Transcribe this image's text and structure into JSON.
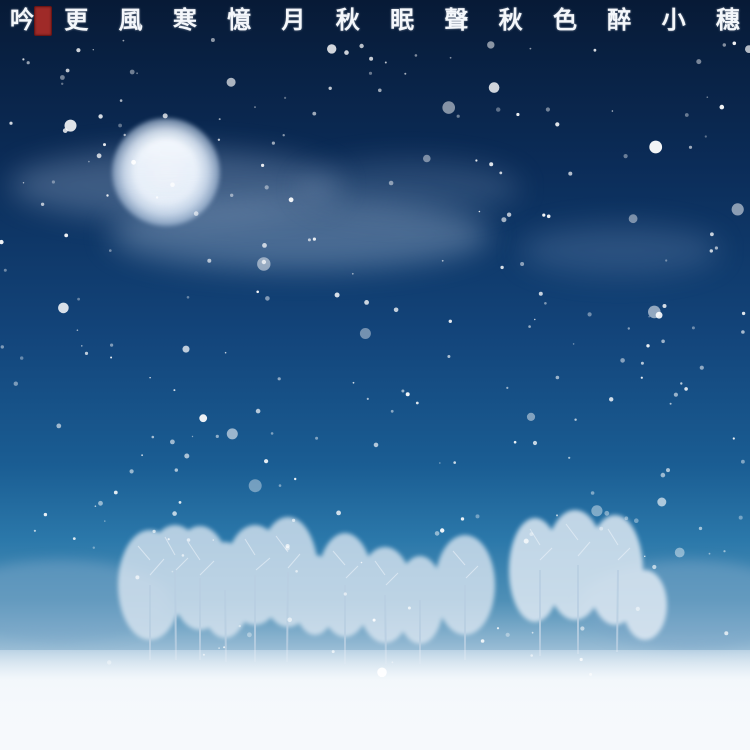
{
  "inscription": {
    "characters": [
      "吟",
      "更",
      "風",
      "寒",
      "憶",
      "月",
      "秋",
      "眠",
      "聲",
      "秋",
      "色",
      "醉",
      "小",
      "穗"
    ],
    "seal": "red-seal-stamp"
  },
  "scene": {
    "subject": "moonlit snowy winter night with a row of frosted trees",
    "moon_icon": "full-moon",
    "colors": {
      "sky_top": "#071a36",
      "sky_mid": "#13457b",
      "horizon": "#4e8fb6",
      "snow_ground": "#f3f7fb",
      "frost_trees": "#dfe9f3",
      "seal": "#9f2a28"
    }
  }
}
